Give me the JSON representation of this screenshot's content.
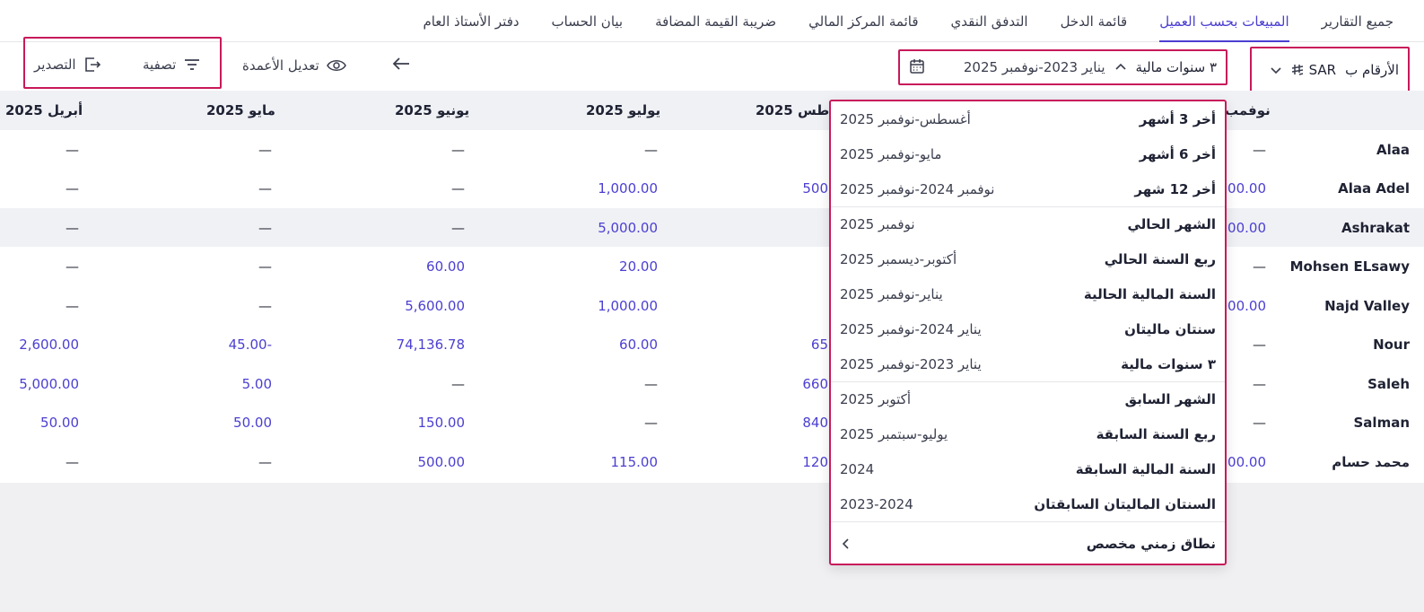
{
  "tabs": [
    {
      "label": "جميع التقارير"
    },
    {
      "label": "المبيعات بحسب العميل",
      "active": true
    },
    {
      "label": "قائمة الدخل"
    },
    {
      "label": "التدفق النقدي"
    },
    {
      "label": "قائمة المركز المالي"
    },
    {
      "label": "ضريبة القيمة المضافة"
    },
    {
      "label": "بيان الحساب"
    },
    {
      "label": "دفتر الأستاذ العام"
    }
  ],
  "toolbar": {
    "numbers_in_label": "الأرقام ب",
    "currency": "SAR",
    "date_preset": "٣ سنوات مالية",
    "date_range": "يناير 2023-نوفمبر 2025",
    "filter_label": "تصفية",
    "export_label": "التصدير",
    "columns_label": "تعديل الأعمدة"
  },
  "table": {
    "headers": [
      "نوفمبر 2025",
      "أغسطس 2025",
      "يوليو 2025",
      "يونيو 2025",
      "مايو 2025",
      "أبريل 2025"
    ],
    "header_visible_partial": [
      "نوفمب",
      "طس 2025"
    ],
    "rows": [
      {
        "name": "Alaa",
        "c0": "—",
        "c1": "",
        "c2": "—",
        "c3": "—",
        "c4": "—",
        "c5": "—"
      },
      {
        "name": "Alaa Adel",
        "c0": "00.00",
        "c1": "500",
        "c2": "1,000.00",
        "c3": "—",
        "c4": "—",
        "c5": "—"
      },
      {
        "name": "Ashrakat",
        "c0": "00.00",
        "c1": "",
        "c2": "5,000.00",
        "c3": "—",
        "c4": "—",
        "c5": "—"
      },
      {
        "name": "Mohsen ELsawy",
        "c0": "—",
        "c1": "",
        "c2": "20.00",
        "c3": "60.00",
        "c4": "—",
        "c5": "—"
      },
      {
        "name": "Najd Valley",
        "c0": "00.00",
        "c1": "",
        "c2": "1,000.00",
        "c3": "5,600.00",
        "c4": "—",
        "c5": "—"
      },
      {
        "name": "Nour",
        "c0": "—",
        "c1": "65",
        "c2": "60.00",
        "c3": "74,136.78",
        "c4": "-45.00",
        "c5": "2,600.00"
      },
      {
        "name": "Saleh",
        "c0": "—",
        "c1": "660",
        "c2": "—",
        "c3": "—",
        "c4": "5.00",
        "c5": "5,000.00"
      },
      {
        "name": "Salman",
        "c0": "—",
        "c1": "840",
        "c2": "—",
        "c3": "150.00",
        "c4": "50.00",
        "c5": "50.00"
      },
      {
        "name": "محمد حسام",
        "c0": "00.00",
        "c1": "120",
        "c2": "115.00",
        "c3": "500.00",
        "c4": "—",
        "c5": "—"
      }
    ]
  },
  "dropdown": {
    "options": [
      {
        "label": "أخر 3 أشهر",
        "range": "أغسطس-نوفمبر 2025"
      },
      {
        "label": "أخر 6 أشهر",
        "range": "مايو-نوفمبر 2025"
      },
      {
        "label": "أخر 12 شهر",
        "range": "نوفمبر 2024-نوفمبر 2025"
      },
      {
        "label": "الشهر الحالي",
        "range": "نوفمبر 2025"
      },
      {
        "label": "ربع السنة الحالي",
        "range": "أكتوبر-ديسمبر 2025"
      },
      {
        "label": "السنة المالية الحالية",
        "range": "يناير-نوفمبر 2025"
      },
      {
        "label": "سنتان ماليتان",
        "range": "يناير 2024-نوفمبر 2025"
      },
      {
        "label": "٣ سنوات مالية",
        "range": "يناير 2023-نوفمبر 2025"
      },
      {
        "label": "الشهر السابق",
        "range": "أكتوبر 2025"
      },
      {
        "label": "ربع السنة السابقة",
        "range": "يوليو-سبتمبر 2025"
      },
      {
        "label": "السنة المالية السابقة",
        "range": "2024"
      },
      {
        "label": "السنتان الماليتان السابقتان",
        "range": "2023-2024"
      }
    ],
    "custom_label": "نطاق زمني مخصص"
  },
  "colors": {
    "accent": "#4b3fd1",
    "highlight_border": "#c8195a",
    "header_bg": "#f0f1f5"
  }
}
